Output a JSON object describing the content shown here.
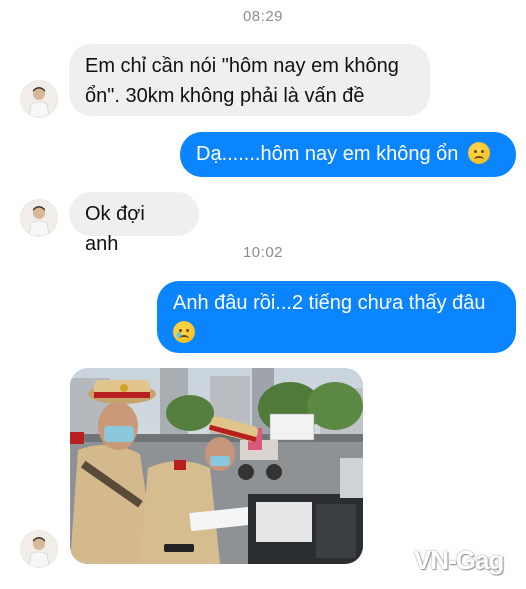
{
  "chat": {
    "timestamps": [
      "08:29",
      "10:02"
    ],
    "messages": [
      {
        "direction": "incoming",
        "lines": [
          "Em chỉ cần nói \"hôm nay em không",
          "ổn\". 30km không phải là vấn đề"
        ]
      },
      {
        "direction": "outgoing",
        "text": "Dạ.......hôm nay em không ổn",
        "emoji": "sad-face-emoji"
      },
      {
        "direction": "incoming",
        "text": "Ok đợi anh"
      },
      {
        "direction": "outgoing",
        "text": "Anh đâu rồi...2 tiếng chưa thấy đâu",
        "emoji": "crying-face-emoji"
      },
      {
        "direction": "incoming",
        "type": "photo",
        "content": "traffic-police-photo"
      }
    ]
  },
  "colors": {
    "outgoing_bubble": "#0b84ff",
    "incoming_bubble": "#efeff1",
    "timestamp": "#8a8d91"
  },
  "watermark": "VN-Gag"
}
